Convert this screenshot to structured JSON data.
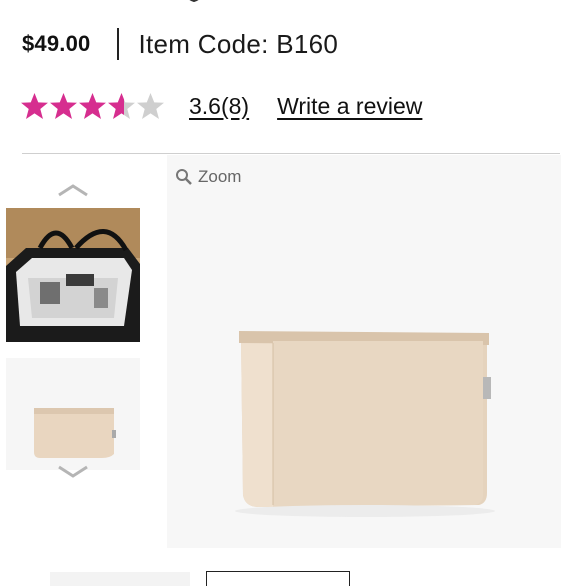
{
  "product": {
    "price": "$49.00",
    "item_code": "Item Code: B160"
  },
  "rating": {
    "value": 3.6,
    "max": 5,
    "score_text": "3.6",
    "count_text": "(8)",
    "write_review": "Write a review",
    "star_color": "#d62e8f",
    "star_empty_color": "#cfcfcf"
  },
  "gallery": {
    "zoom_label": "Zoom",
    "thumbnails": [
      {
        "alt": "Tote bag interior with organizer insert"
      },
      {
        "alt": "Beige bag organizer insert"
      }
    ]
  }
}
